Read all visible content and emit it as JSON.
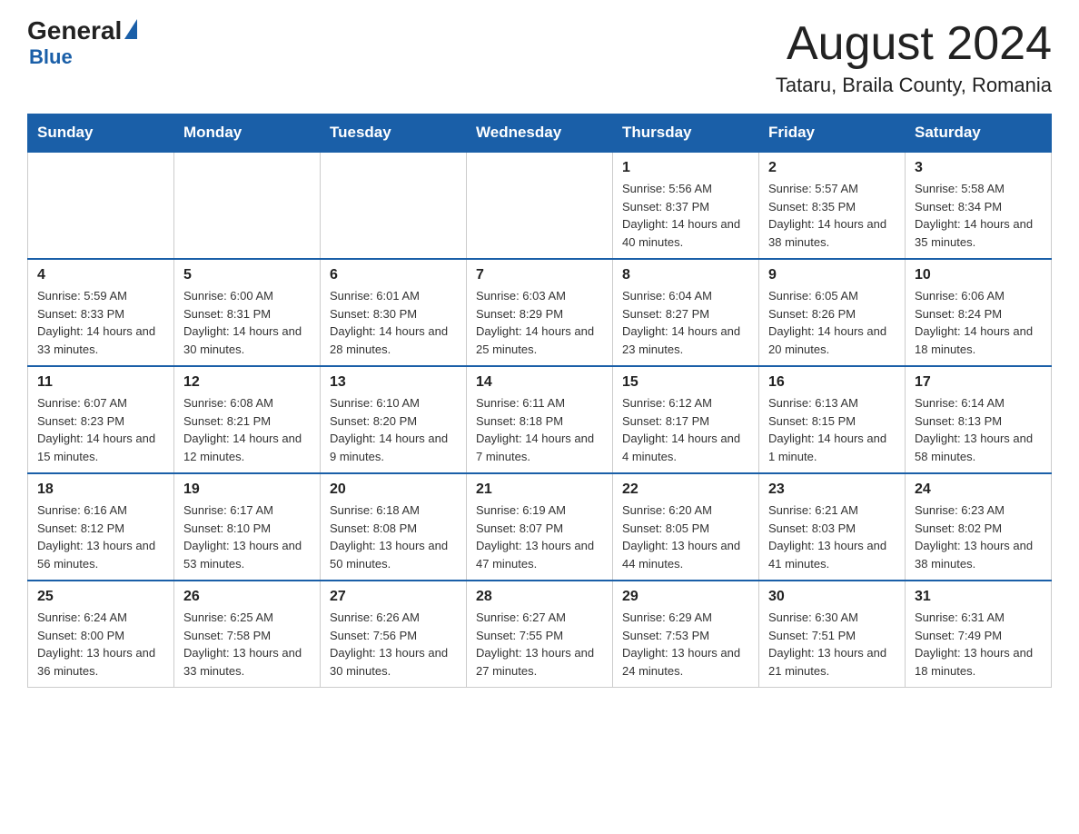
{
  "logo": {
    "general": "General",
    "blue": "Blue"
  },
  "title": "August 2024",
  "subtitle": "Tataru, Braila County, Romania",
  "days_of_week": [
    "Sunday",
    "Monday",
    "Tuesday",
    "Wednesday",
    "Thursday",
    "Friday",
    "Saturday"
  ],
  "weeks": [
    [
      {
        "day": "",
        "info": ""
      },
      {
        "day": "",
        "info": ""
      },
      {
        "day": "",
        "info": ""
      },
      {
        "day": "",
        "info": ""
      },
      {
        "day": "1",
        "info": "Sunrise: 5:56 AM\nSunset: 8:37 PM\nDaylight: 14 hours and 40 minutes."
      },
      {
        "day": "2",
        "info": "Sunrise: 5:57 AM\nSunset: 8:35 PM\nDaylight: 14 hours and 38 minutes."
      },
      {
        "day": "3",
        "info": "Sunrise: 5:58 AM\nSunset: 8:34 PM\nDaylight: 14 hours and 35 minutes."
      }
    ],
    [
      {
        "day": "4",
        "info": "Sunrise: 5:59 AM\nSunset: 8:33 PM\nDaylight: 14 hours and 33 minutes."
      },
      {
        "day": "5",
        "info": "Sunrise: 6:00 AM\nSunset: 8:31 PM\nDaylight: 14 hours and 30 minutes."
      },
      {
        "day": "6",
        "info": "Sunrise: 6:01 AM\nSunset: 8:30 PM\nDaylight: 14 hours and 28 minutes."
      },
      {
        "day": "7",
        "info": "Sunrise: 6:03 AM\nSunset: 8:29 PM\nDaylight: 14 hours and 25 minutes."
      },
      {
        "day": "8",
        "info": "Sunrise: 6:04 AM\nSunset: 8:27 PM\nDaylight: 14 hours and 23 minutes."
      },
      {
        "day": "9",
        "info": "Sunrise: 6:05 AM\nSunset: 8:26 PM\nDaylight: 14 hours and 20 minutes."
      },
      {
        "day": "10",
        "info": "Sunrise: 6:06 AM\nSunset: 8:24 PM\nDaylight: 14 hours and 18 minutes."
      }
    ],
    [
      {
        "day": "11",
        "info": "Sunrise: 6:07 AM\nSunset: 8:23 PM\nDaylight: 14 hours and 15 minutes."
      },
      {
        "day": "12",
        "info": "Sunrise: 6:08 AM\nSunset: 8:21 PM\nDaylight: 14 hours and 12 minutes."
      },
      {
        "day": "13",
        "info": "Sunrise: 6:10 AM\nSunset: 8:20 PM\nDaylight: 14 hours and 9 minutes."
      },
      {
        "day": "14",
        "info": "Sunrise: 6:11 AM\nSunset: 8:18 PM\nDaylight: 14 hours and 7 minutes."
      },
      {
        "day": "15",
        "info": "Sunrise: 6:12 AM\nSunset: 8:17 PM\nDaylight: 14 hours and 4 minutes."
      },
      {
        "day": "16",
        "info": "Sunrise: 6:13 AM\nSunset: 8:15 PM\nDaylight: 14 hours and 1 minute."
      },
      {
        "day": "17",
        "info": "Sunrise: 6:14 AM\nSunset: 8:13 PM\nDaylight: 13 hours and 58 minutes."
      }
    ],
    [
      {
        "day": "18",
        "info": "Sunrise: 6:16 AM\nSunset: 8:12 PM\nDaylight: 13 hours and 56 minutes."
      },
      {
        "day": "19",
        "info": "Sunrise: 6:17 AM\nSunset: 8:10 PM\nDaylight: 13 hours and 53 minutes."
      },
      {
        "day": "20",
        "info": "Sunrise: 6:18 AM\nSunset: 8:08 PM\nDaylight: 13 hours and 50 minutes."
      },
      {
        "day": "21",
        "info": "Sunrise: 6:19 AM\nSunset: 8:07 PM\nDaylight: 13 hours and 47 minutes."
      },
      {
        "day": "22",
        "info": "Sunrise: 6:20 AM\nSunset: 8:05 PM\nDaylight: 13 hours and 44 minutes."
      },
      {
        "day": "23",
        "info": "Sunrise: 6:21 AM\nSunset: 8:03 PM\nDaylight: 13 hours and 41 minutes."
      },
      {
        "day": "24",
        "info": "Sunrise: 6:23 AM\nSunset: 8:02 PM\nDaylight: 13 hours and 38 minutes."
      }
    ],
    [
      {
        "day": "25",
        "info": "Sunrise: 6:24 AM\nSunset: 8:00 PM\nDaylight: 13 hours and 36 minutes."
      },
      {
        "day": "26",
        "info": "Sunrise: 6:25 AM\nSunset: 7:58 PM\nDaylight: 13 hours and 33 minutes."
      },
      {
        "day": "27",
        "info": "Sunrise: 6:26 AM\nSunset: 7:56 PM\nDaylight: 13 hours and 30 minutes."
      },
      {
        "day": "28",
        "info": "Sunrise: 6:27 AM\nSunset: 7:55 PM\nDaylight: 13 hours and 27 minutes."
      },
      {
        "day": "29",
        "info": "Sunrise: 6:29 AM\nSunset: 7:53 PM\nDaylight: 13 hours and 24 minutes."
      },
      {
        "day": "30",
        "info": "Sunrise: 6:30 AM\nSunset: 7:51 PM\nDaylight: 13 hours and 21 minutes."
      },
      {
        "day": "31",
        "info": "Sunrise: 6:31 AM\nSunset: 7:49 PM\nDaylight: 13 hours and 18 minutes."
      }
    ]
  ]
}
